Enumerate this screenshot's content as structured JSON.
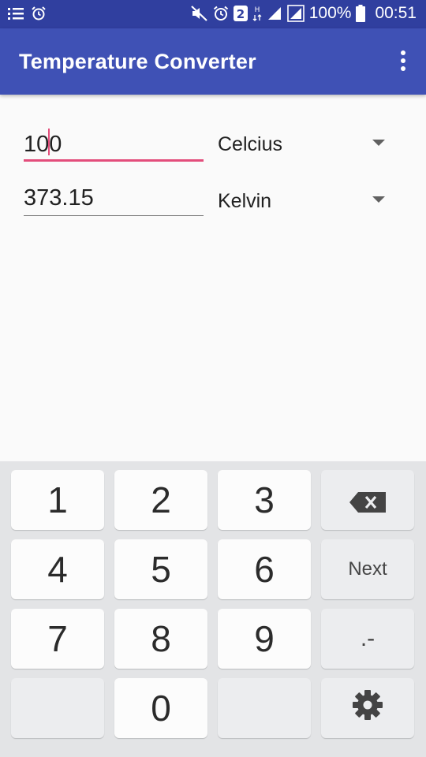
{
  "status_bar": {
    "battery_text": "100%",
    "time": "00:51"
  },
  "app_bar": {
    "title": "Temperature Converter"
  },
  "converter": {
    "input_value": "100",
    "input_unit": "Celcius",
    "output_value": "373.15",
    "output_unit": "Kelvin"
  },
  "keyboard": {
    "keys": {
      "k1": "1",
      "k2": "2",
      "k3": "3",
      "k4": "4",
      "k5": "5",
      "k6": "6",
      "k7": "7",
      "k8": "8",
      "k9": "9",
      "k0": "0",
      "next": "Next",
      "dot_minus": ".-"
    }
  },
  "colors": {
    "status_bar": "#303f9f",
    "app_bar": "#3f51b5",
    "accent": "#e34d7b"
  }
}
